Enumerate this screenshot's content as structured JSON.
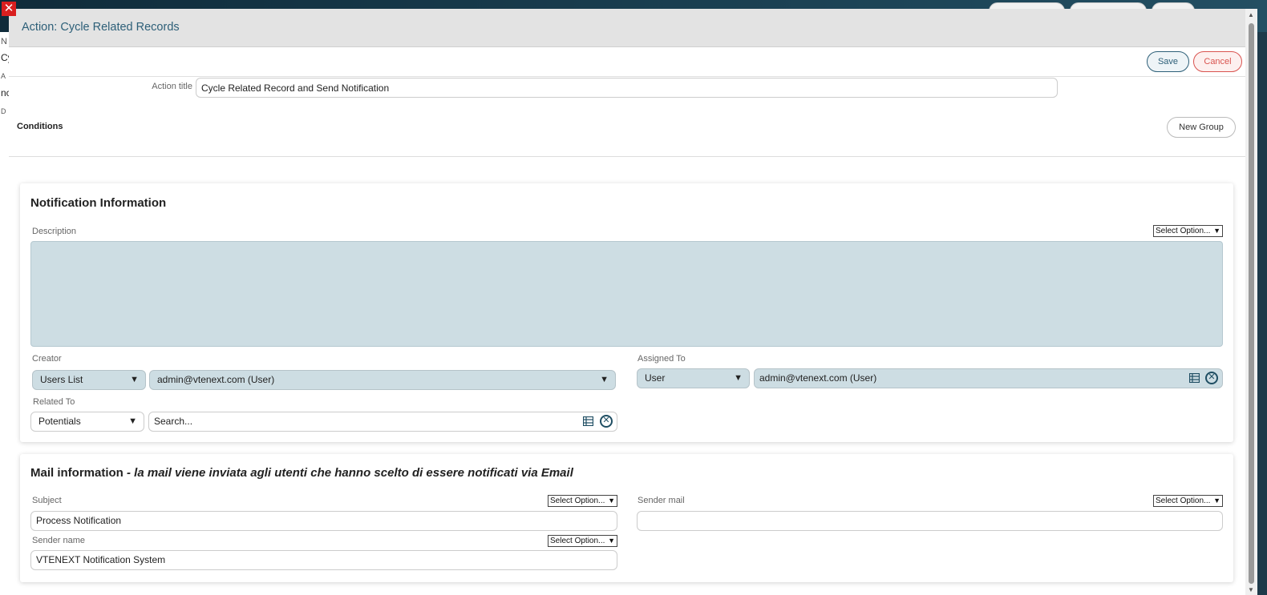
{
  "background": {
    "fragments": [
      "N",
      "Cy",
      "A",
      "nc",
      "D"
    ]
  },
  "close_icon_glyph": "✕",
  "modal": {
    "title": "Action: Cycle Related Records",
    "save_label": "Save",
    "cancel_label": "Cancel",
    "action_title_label": "Action title",
    "action_title_value": "Cycle Related Record and Send Notification",
    "conditions_label": "Conditions",
    "new_group_label": "New Group"
  },
  "notification": {
    "title": "Notification Information",
    "description_label": "Description",
    "select_option": "Select Option...",
    "description_value": "",
    "creator_label": "Creator",
    "creator_type": "Users List",
    "creator_value": "admin@vtenext.com (User)",
    "assigned_label": "Assigned To",
    "assigned_type": "User",
    "assigned_value": "admin@vtenext.com (User)",
    "related_label": "Related To",
    "related_type": "Potentials",
    "related_search_placeholder": "Search..."
  },
  "mail": {
    "title": "Mail information",
    "subtitle": " - la mail viene inviata agli utenti che hanno scelto di essere notificati via Email",
    "subject_label": "Subject",
    "subject_value": "Process Notification",
    "sender_mail_label": "Sender mail",
    "sender_mail_value": "",
    "sender_name_label": "Sender name",
    "sender_name_value": "VTENEXT Notification System",
    "select_option": "Select Option..."
  },
  "colors": {
    "accent": "#2d5f78",
    "danger": "#d9534f",
    "field_bg": "#cddde3"
  }
}
